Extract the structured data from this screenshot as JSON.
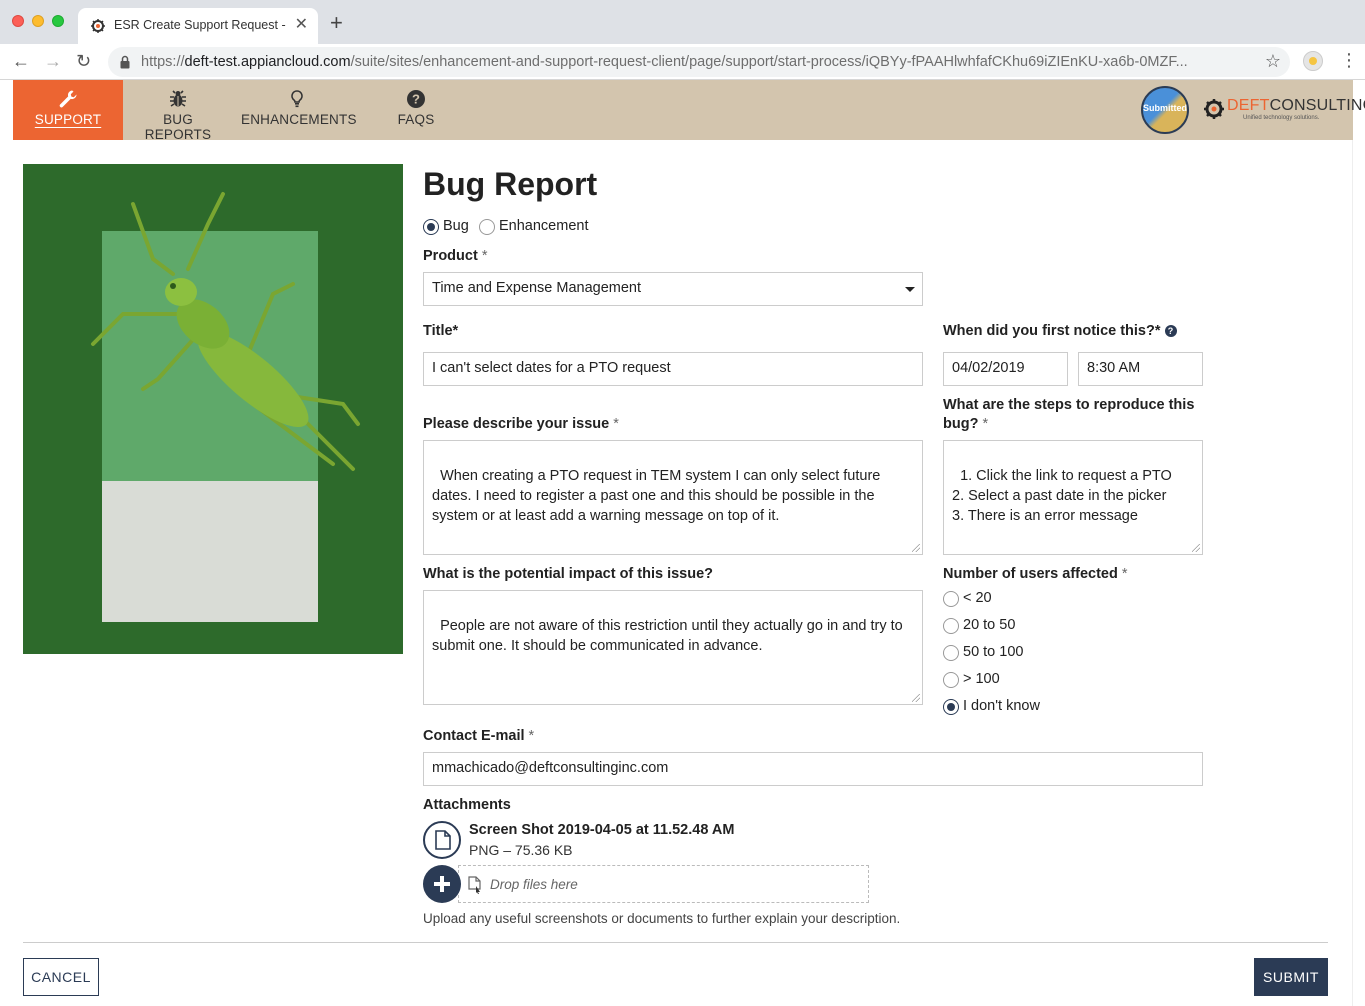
{
  "browser": {
    "tab_title": "ESR Create Support Request -",
    "tab_close": "✕",
    "new_tab": "+",
    "url_prefix": "https://",
    "url_host": "deft-test.appiancloud.com",
    "url_path": "/suite/sites/enhancement-and-support-request-client/page/support/start-process/iQBYy-fPAAHlwhfafCKhu69iZIEnKU-xa6b-0MZF..."
  },
  "nav": {
    "items": [
      {
        "label": "SUPPORT",
        "icon": "wrench-icon",
        "active": true
      },
      {
        "label": "BUG REPORTS",
        "icon": "bug-icon",
        "active": false
      },
      {
        "label": "ENHANCEMENTS",
        "icon": "lightbulb-icon",
        "active": false
      },
      {
        "label": "FAQS",
        "icon": "question-circle-icon",
        "active": false
      }
    ],
    "badge_text": "Submitted",
    "logo_deft": "DEFT",
    "logo_consulting": "CONSULTING",
    "logo_tagline": "Unified technology solutions."
  },
  "form": {
    "title": "Bug Report",
    "type_options": [
      {
        "label": "Bug",
        "selected": true
      },
      {
        "label": "Enhancement",
        "selected": false
      }
    ],
    "product": {
      "label": "Product",
      "required_mark": "*",
      "value": "Time and Expense Management"
    },
    "title_field": {
      "label": "Title*",
      "value": "I can't select dates for a PTO request"
    },
    "notice": {
      "label": "When did you first notice this?*",
      "help_icon": "?",
      "date": "04/02/2019",
      "time": "8:30 AM"
    },
    "description": {
      "label": "Please describe your issue",
      "required_mark": "*",
      "value": "When creating a PTO request in TEM system I can only select future dates. I need to register a past one and this should be possible in the system or at least add a warning message on top of it."
    },
    "steps": {
      "label_line1": "What are the steps to reproduce this",
      "label_line2": "bug?",
      "required_mark": "*",
      "value": "1. Click the link to request a PTO\n2. Select a past date in the picker\n3. There is an error message"
    },
    "impact": {
      "label": "What is the potential impact of this issue?",
      "value": "People are not aware of this restriction until they actually go in and try to submit one. It should be communicated in advance."
    },
    "users_affected": {
      "label": "Number of users affected",
      "required_mark": "*",
      "options": [
        {
          "label": "< 20",
          "selected": false
        },
        {
          "label": "20 to 50",
          "selected": false
        },
        {
          "label": "50 to 100",
          "selected": false
        },
        {
          "label": "> 100",
          "selected": false
        },
        {
          "label": "I don't know",
          "selected": true
        }
      ]
    },
    "email": {
      "label": "Contact E-mail",
      "required_mark": "*",
      "value": "mmachicado@deftconsultinginc.com"
    },
    "attachments": {
      "label": "Attachments",
      "file_name": "Screen Shot 2019-04-05 at 11.52.48 AM",
      "file_meta": "PNG – 75.36 KB",
      "drop_text": "Drop files here",
      "help_text": "Upload any useful screenshots or documents to further explain your description."
    },
    "cancel_label": "CANCEL",
    "submit_label": "SUBMIT"
  },
  "colors": {
    "accent_orange": "#ec6532",
    "header_tan": "#d3c5ae",
    "primary_navy": "#2b3b55"
  }
}
